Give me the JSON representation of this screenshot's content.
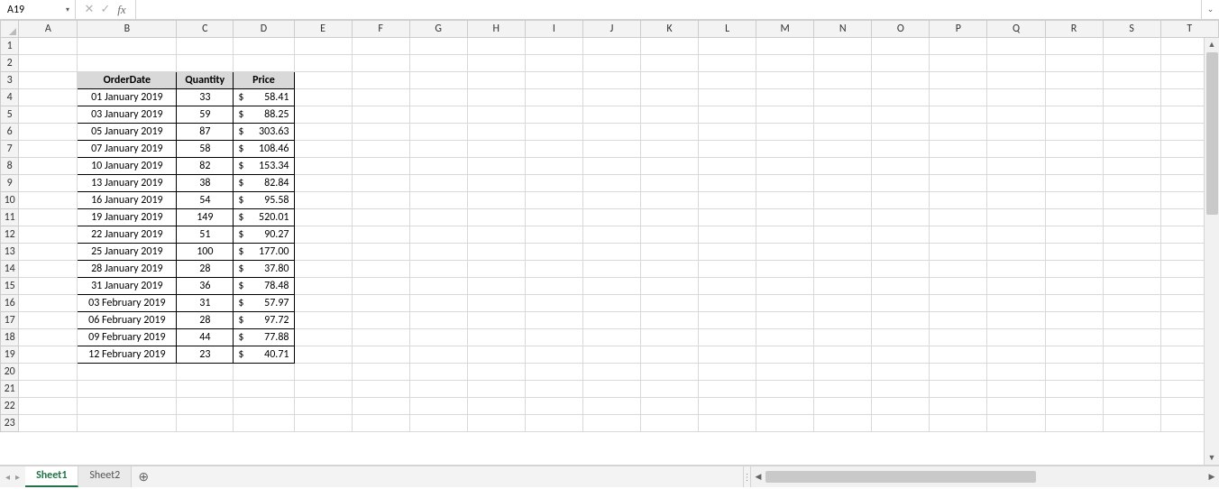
{
  "formula_bar": {
    "name_box_value": "A19",
    "cancel_glyph": "✕",
    "confirm_glyph": "✓",
    "fx_label": "fx",
    "formula_value": "",
    "expand_glyph": "⌄"
  },
  "grid": {
    "columns": [
      "A",
      "B",
      "C",
      "D",
      "E",
      "F",
      "G",
      "H",
      "I",
      "J",
      "K",
      "L",
      "M",
      "N",
      "O",
      "P",
      "Q",
      "R",
      "S",
      "T"
    ],
    "row_numbers": [
      1,
      2,
      3,
      4,
      5,
      6,
      7,
      8,
      9,
      10,
      11,
      12,
      13,
      14,
      15,
      16,
      17,
      18,
      19,
      20,
      21,
      22,
      23
    ]
  },
  "table": {
    "header": {
      "order_date": "OrderDate",
      "quantity": "Quantity",
      "price": "Price"
    },
    "currency_symbol": "$",
    "rows": [
      {
        "date": "01 January 2019",
        "qty": "33",
        "price": "58.41"
      },
      {
        "date": "03 January 2019",
        "qty": "59",
        "price": "88.25"
      },
      {
        "date": "05 January 2019",
        "qty": "87",
        "price": "303.63"
      },
      {
        "date": "07 January 2019",
        "qty": "58",
        "price": "108.46"
      },
      {
        "date": "10 January 2019",
        "qty": "82",
        "price": "153.34"
      },
      {
        "date": "13 January 2019",
        "qty": "38",
        "price": "82.84"
      },
      {
        "date": "16 January 2019",
        "qty": "54",
        "price": "95.58"
      },
      {
        "date": "19 January 2019",
        "qty": "149",
        "price": "520.01"
      },
      {
        "date": "22 January 2019",
        "qty": "51",
        "price": "90.27"
      },
      {
        "date": "25 January 2019",
        "qty": "100",
        "price": "177.00"
      },
      {
        "date": "28 January 2019",
        "qty": "28",
        "price": "37.80"
      },
      {
        "date": "31 January 2019",
        "qty": "36",
        "price": "78.48"
      },
      {
        "date": "03 February 2019",
        "qty": "31",
        "price": "57.97"
      },
      {
        "date": "06 February 2019",
        "qty": "28",
        "price": "97.72"
      },
      {
        "date": "09 February 2019",
        "qty": "44",
        "price": "77.88"
      },
      {
        "date": "12 February 2019",
        "qty": "23",
        "price": "40.71"
      }
    ]
  },
  "tabs": {
    "nav_prev": "◂",
    "nav_next": "▸",
    "vdots": "⋮",
    "items": [
      "Sheet1",
      "Sheet2"
    ],
    "active_index": 0,
    "add_glyph": "⊕"
  },
  "scroll": {
    "up": "▲",
    "down": "▼",
    "left": "◀",
    "right": "▶"
  }
}
